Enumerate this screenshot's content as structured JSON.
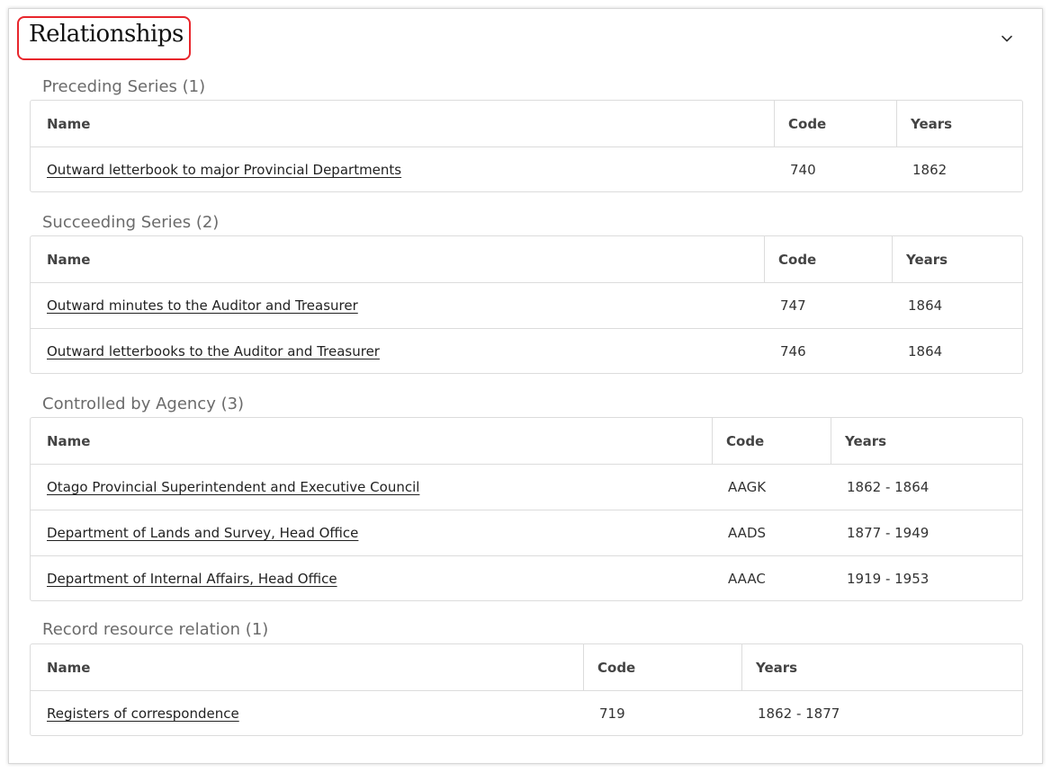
{
  "title": "Relationships",
  "columns": {
    "name": "Name",
    "code": "Code",
    "years": "Years"
  },
  "preceding": {
    "title": "Preceding Series (1)",
    "rows": [
      {
        "name": "Outward letterbook to major Provincial Departments",
        "code": "740",
        "years": "1862"
      }
    ]
  },
  "succeeding": {
    "title": "Succeeding Series (2)",
    "rows": [
      {
        "name": "Outward minutes to the Auditor and Treasurer",
        "code": "747",
        "years": "1864"
      },
      {
        "name": "Outward letterbooks to the Auditor and Treasurer",
        "code": "746",
        "years": "1864"
      }
    ]
  },
  "agency": {
    "title": "Controlled by Agency (3)",
    "rows": [
      {
        "name": "Otago Provincial Superintendent and Executive Council",
        "code": "AAGK",
        "years": "1862 - 1864"
      },
      {
        "name": "Department of Lands and Survey, Head Office",
        "code": "AADS",
        "years": "1877 - 1949"
      },
      {
        "name": "Department of Internal Affairs, Head Office",
        "code": "AAAC",
        "years": "1919 - 1953"
      }
    ]
  },
  "record": {
    "title": "Record resource relation (1)",
    "rows": [
      {
        "name": "Registers of correspondence",
        "code": "719",
        "years": "1862 - 1877"
      }
    ]
  },
  "icons": {
    "collapse": "chevron-down-icon"
  },
  "colors": {
    "highlight": "#e8262c"
  }
}
